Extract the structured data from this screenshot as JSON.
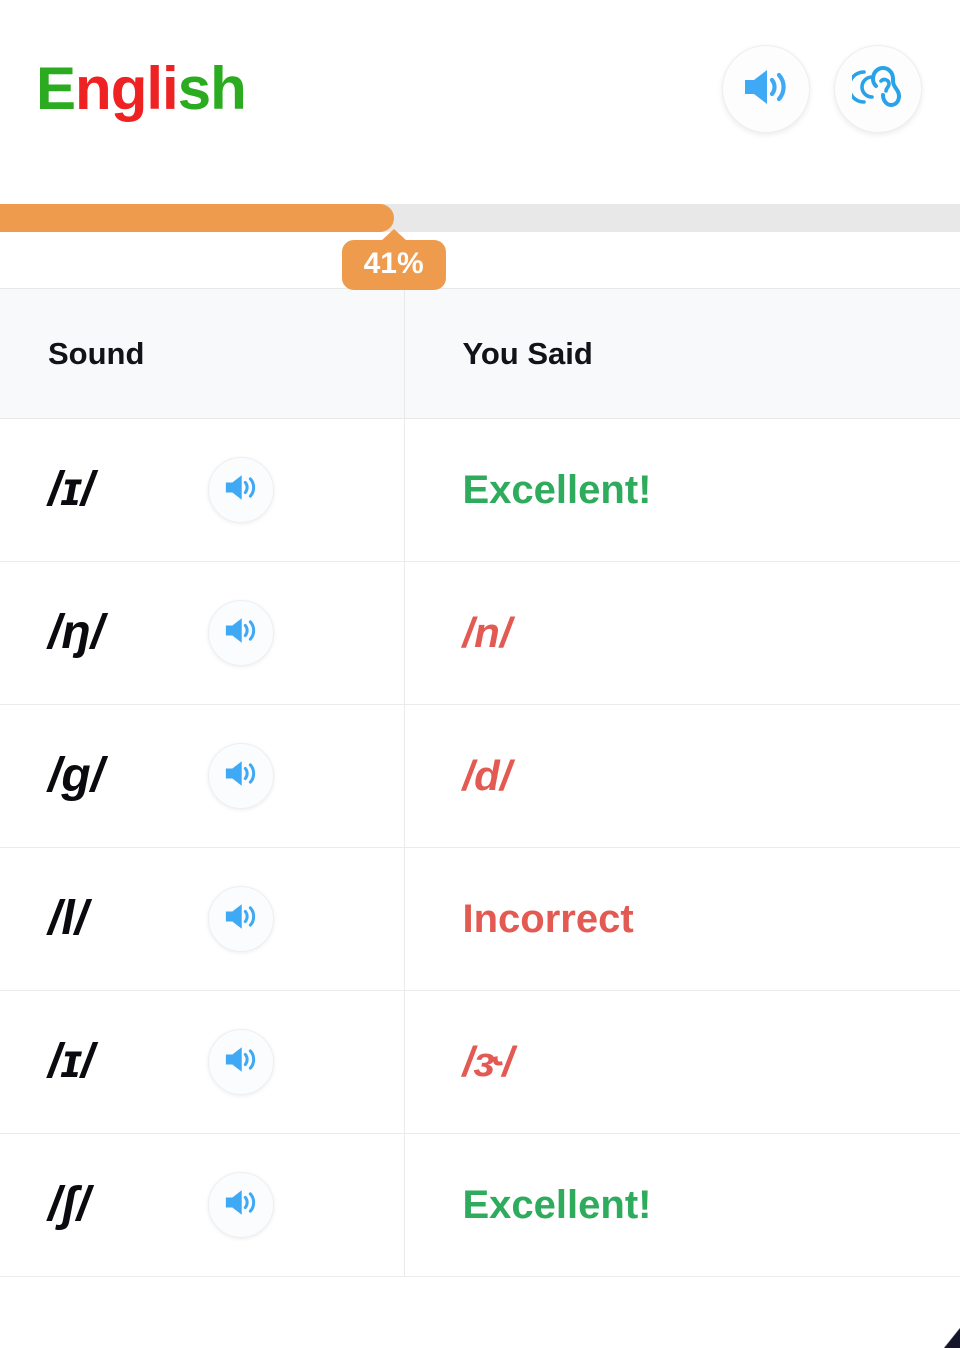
{
  "header": {
    "title_letters": [
      {
        "char": "E",
        "color": "#2bab1f"
      },
      {
        "char": "n",
        "color": "#ee2222"
      },
      {
        "char": "g",
        "color": "#ee2222"
      },
      {
        "char": "l",
        "color": "#ee2222"
      },
      {
        "char": "i",
        "color": "#ee2222"
      },
      {
        "char": "s",
        "color": "#2bab1f"
      },
      {
        "char": "h",
        "color": "#2bab1f"
      }
    ],
    "title_text": "English",
    "actions": [
      {
        "name": "speaker-icon",
        "label": "Play audio"
      },
      {
        "name": "ear-listen-icon",
        "label": "Listen"
      }
    ]
  },
  "progress": {
    "percent": 41,
    "percent_label": "41%",
    "fill_color": "#ee9b4e",
    "track_color": "#e8e8e8"
  },
  "table": {
    "columns": [
      {
        "key": "sound",
        "label": "Sound"
      },
      {
        "key": "said",
        "label": "You Said"
      }
    ],
    "rows": [
      {
        "sound": "/ɪ/",
        "said": "Excellent!",
        "said_kind": "word",
        "said_color": "#2eab5d",
        "correct": true
      },
      {
        "sound": "/ŋ/",
        "said": "/n/",
        "said_kind": "ipa",
        "said_color": "#e35a52",
        "correct": false
      },
      {
        "sound": "/g/",
        "said": "/d/",
        "said_kind": "ipa",
        "said_color": "#e35a52",
        "correct": false
      },
      {
        "sound": "/l/",
        "said": "Incorrect",
        "said_kind": "word",
        "said_color": "#e35a52",
        "correct": false
      },
      {
        "sound": "/ɪ/",
        "said": "/ɝ/",
        "said_kind": "ipa",
        "said_color": "#e35a52",
        "correct": false
      },
      {
        "sound": "/ʃ/",
        "said": "Excellent!",
        "said_kind": "word",
        "said_color": "#2eab5d",
        "correct": true
      }
    ],
    "play_button_label": "Play sound"
  },
  "colors": {
    "green": "#2eab5d",
    "red": "#e35a52",
    "blue": "#3fa9f5",
    "orange": "#ee9b4e"
  }
}
